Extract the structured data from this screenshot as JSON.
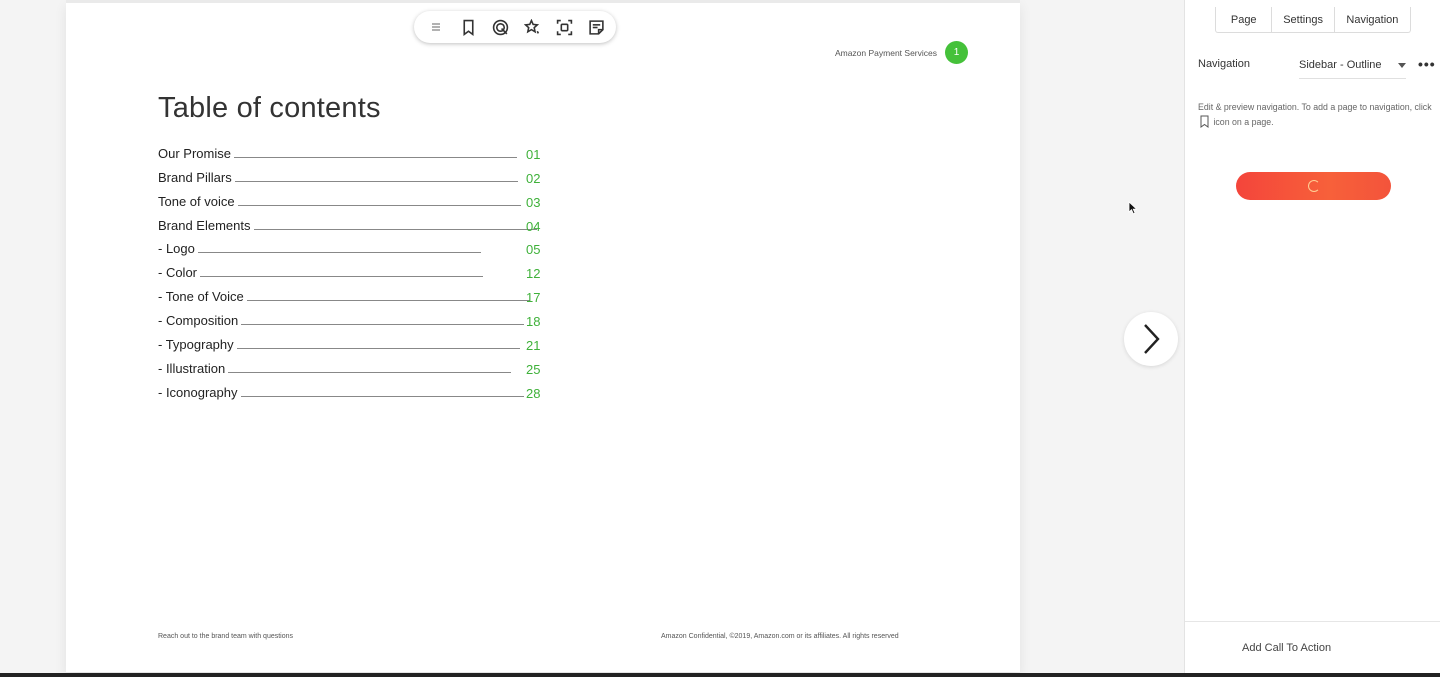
{
  "toolbar": {
    "icons": [
      "drag-handle-icon",
      "bookmark-icon",
      "target-icon",
      "stars-icon",
      "focus-icon",
      "note-icon"
    ]
  },
  "document": {
    "brand": "Amazon Payment Services",
    "page_badge": "1",
    "title": "Table of contents",
    "toc": [
      {
        "label": "Our Promise",
        "page": "01"
      },
      {
        "label": "Brand Pillars",
        "page": "02"
      },
      {
        "label": "Tone of voice",
        "page": "03"
      },
      {
        "label": "Brand Elements",
        "page": "04"
      },
      {
        "label": "- Logo",
        "page": "05"
      },
      {
        "label": "- Color",
        "page": "12"
      },
      {
        "label": "- Tone of Voice",
        "page": "17"
      },
      {
        "label": "- Composition",
        "page": "18"
      },
      {
        "label": "- Typography",
        "page": "21"
      },
      {
        "label": "- Illustration",
        "page": "25"
      },
      {
        "label": "- Iconography",
        "page": "28"
      }
    ],
    "footer_left": "Reach out to the brand team with questions",
    "footer_right": "Amazon Confidential, ©2019, Amazon.com or its affiliates. All rights reserved"
  },
  "panel": {
    "tabs": [
      "Page",
      "Settings",
      "Navigation"
    ],
    "navigation_label": "Navigation",
    "navigation_value": "Sidebar - Outline",
    "more_label": "•••",
    "help_part1": "Edit & preview navigation. To add a page to navigation, click",
    "help_part2": "icon on a page.",
    "cta": "Add Call To Action"
  },
  "colors": {
    "accent_green": "#45c13a",
    "page_number_green": "#3fb13a",
    "button_gradient_start": "#f4453b",
    "button_gradient_end": "#f7603a"
  }
}
